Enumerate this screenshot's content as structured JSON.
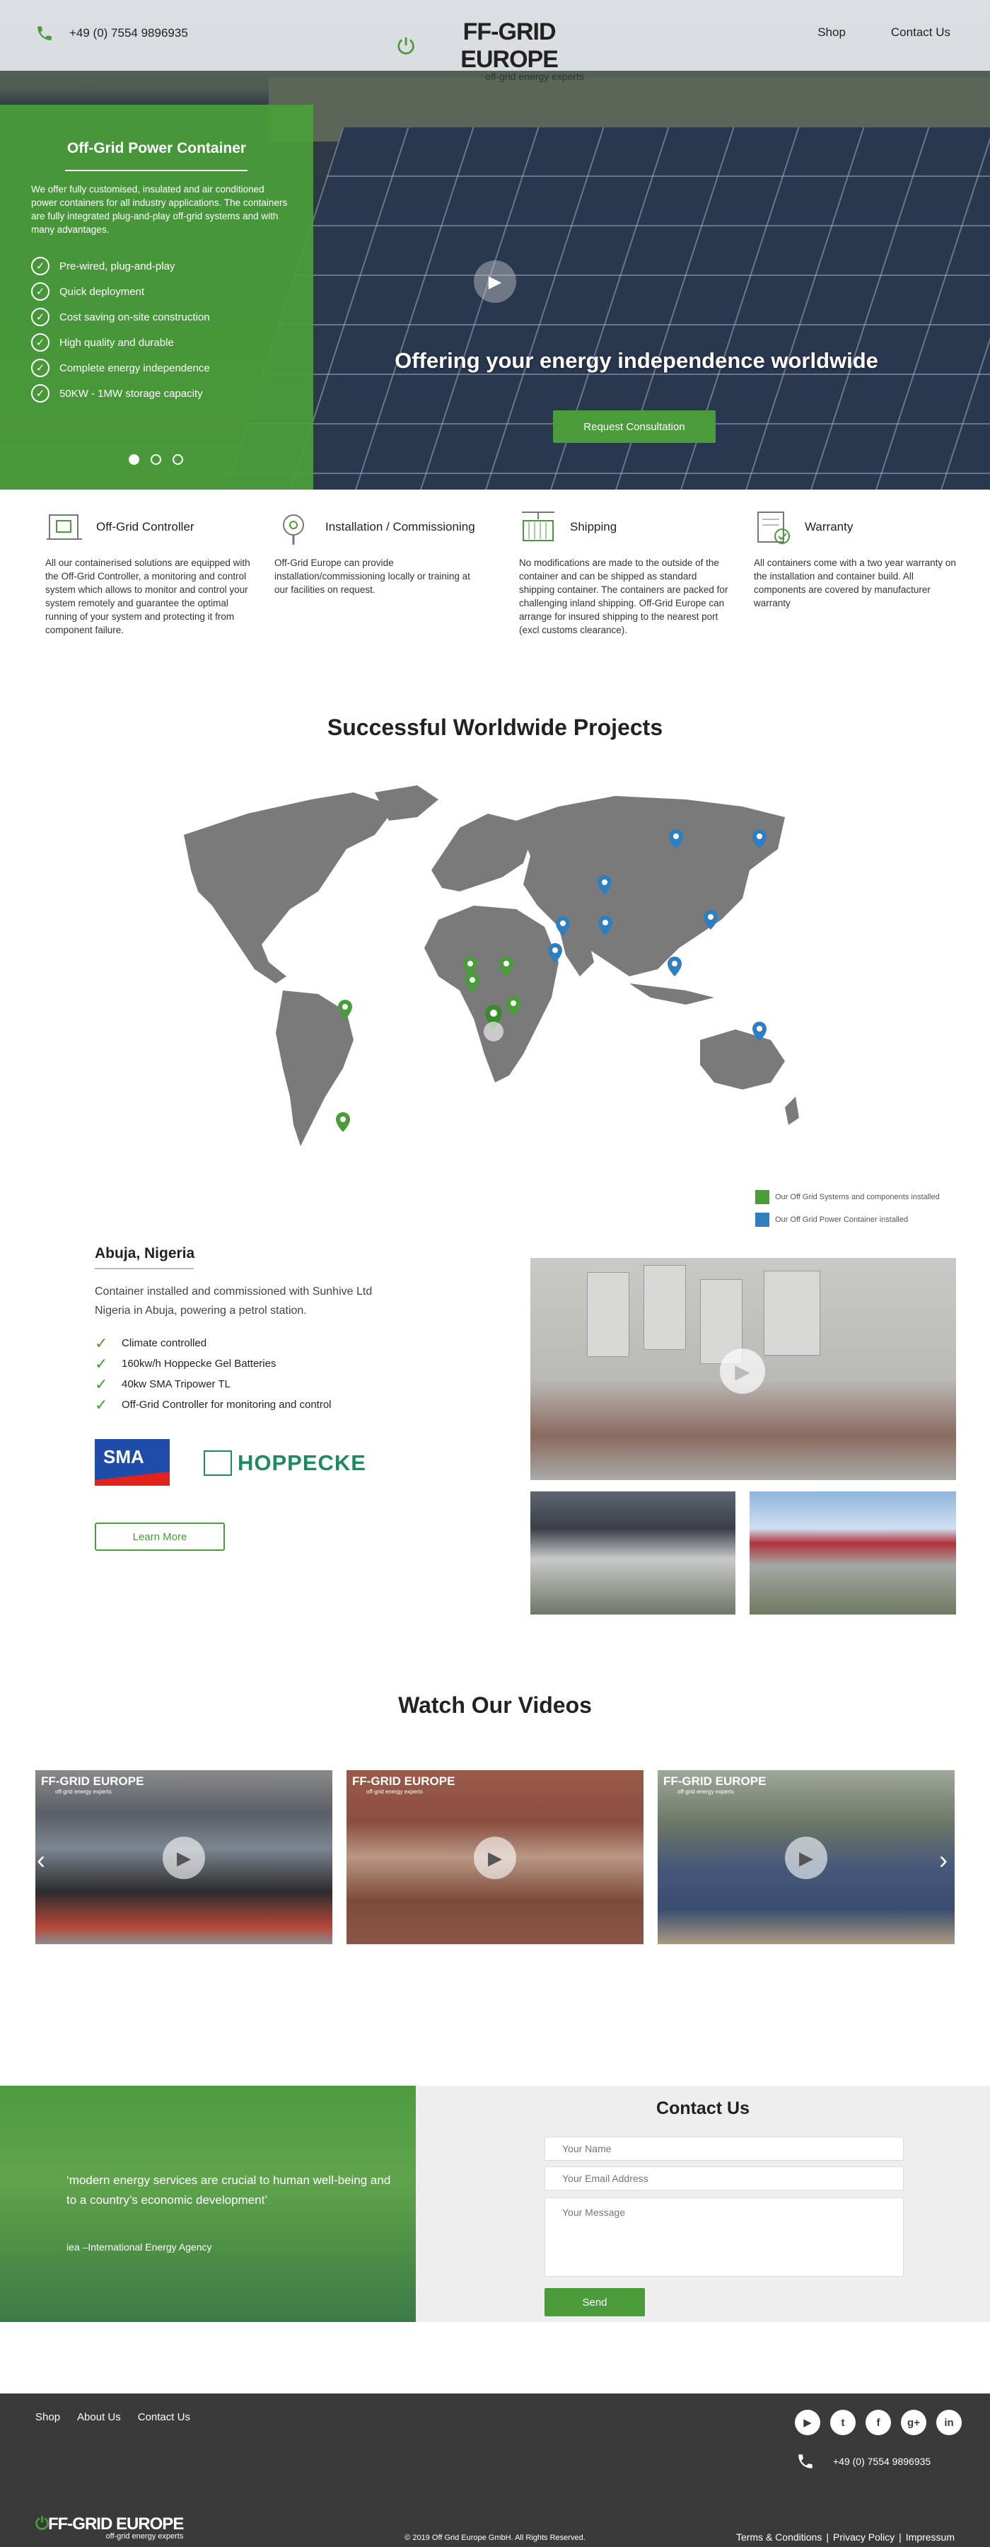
{
  "header": {
    "phone": "+49 (0) 7554 9896935",
    "logo_main": "FF-GRID EUROPE",
    "logo_sub": "off-grid energy experts",
    "nav": [
      "Shop",
      "Contact Us"
    ]
  },
  "hero": {
    "box_title": "Off-Grid Power Container",
    "box_desc": "We offer fully customised, insulated and air conditioned power containers for all industry applications. The containers are fully integrated plug-and-play off-grid systems and with many advantages.",
    "features": [
      "Pre-wired, plug-and-play",
      "Quick deployment",
      "Cost saving on-site construction",
      "High quality and durable",
      "Complete energy independence",
      "50KW - 1MW storage capacity"
    ],
    "headline": "Offering your energy independence worldwide",
    "cta": "Request Consultation",
    "slides": 3,
    "active_slide": 1
  },
  "features": [
    {
      "icon": "controller-icon",
      "title": "Off-Grid Controller",
      "text": "All our containerised solutions are equipped with the Off-Grid Controller, a monitoring and control system which allows to monitor and control your system remotely and guarantee the optimal running of your system and protecting it from component failure."
    },
    {
      "icon": "install-icon",
      "title": "Installation / Commissioning",
      "text": "Off-Grid Europe can provide installation/commissioning locally or training at our facilities on request."
    },
    {
      "icon": "shipping-icon",
      "title": "Shipping",
      "text": "No modifications are made to the outside of the container and can be shipped as standard shipping container. The containers are packed for challenging inland shipping. Off-Grid Europe can arrange for insured shipping to the nearest port (excl customs clearance)."
    },
    {
      "icon": "warranty-icon",
      "title": "Warranty",
      "text": "All containers come with a two year warranty on the installation and container build. All components are covered by manufacturer warranty"
    }
  ],
  "projects": {
    "title": "Successful Worldwide Projects",
    "legend": [
      {
        "label": "Our Off Grid Systems and components installed",
        "color": "#4a9c3b"
      },
      {
        "label": "Our Off Grid Power Container installed",
        "color": "#2f7fc0"
      }
    ],
    "location": "Abuja, Nigeria",
    "desc": "Container installed and commissioned with Sunhive Ltd Nigeria in Abuja, powering a petrol station.",
    "specs": [
      "Climate controlled",
      "160kw/h Hoppecke Gel Batteries",
      "40kw SMA Tripower TL",
      "Off-Grid Controller for monitoring and control"
    ],
    "partner_logos": [
      "SMA",
      "HOPPECKE"
    ],
    "learn_more": "Learn More"
  },
  "videos": {
    "title": "Watch Our Videos",
    "logo_text": "FF-GRID EUROPE",
    "logo_sub": "off-grid energy experts"
  },
  "contact": {
    "quote": "‘modern energy services are crucial to human well-being and to a country’s economic development’",
    "quote_source": "iea –International Energy Agency",
    "title": "Contact Us",
    "name_ph": "Your Name",
    "email_ph": "Your Email Address",
    "message_ph": "Your Message",
    "send": "Send"
  },
  "footer": {
    "nav": [
      "Shop",
      "About Us",
      "Contact Us"
    ],
    "socials": [
      "youtube-icon",
      "twitter-icon",
      "facebook-icon",
      "googleplus-icon",
      "linkedin-icon"
    ],
    "phone": "+49 (0) 7554 9896935",
    "logo_main": "FF-GRID EUROPE",
    "logo_sub": "off-grid energy experts",
    "copyright": "© 2019 Off Grid Europe GmbH. All Rights Reserved.",
    "links": [
      "Terms & Conditions",
      "Privacy Policy",
      "Impressum"
    ]
  },
  "colors": {
    "accent": "#4a9c3b",
    "blue_pin": "#2f7fc0",
    "footer": "#3a3a3a"
  }
}
